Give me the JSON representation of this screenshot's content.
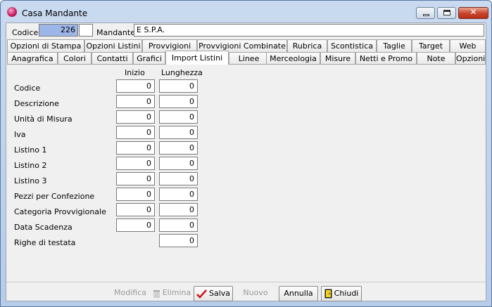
{
  "window": {
    "title": "Casa Mandante"
  },
  "header": {
    "codice_label": "Codice",
    "codice_value": "226",
    "mandante_label": "Mandante",
    "mandante_value": "E        S.P.A."
  },
  "tabs_row1": [
    "Opzioni di Stampa",
    "Opzioni Listini",
    "Provvigioni",
    "Provvigioni Combinate",
    "Rubrica",
    "Scontistica",
    "Taglie",
    "Target",
    "Web"
  ],
  "tabs_row2": [
    "Anagrafica",
    "Colori",
    "Contatti",
    "Grafici",
    "Import Listini",
    "Linee",
    "Merceologia",
    "Misure",
    "Netti e Promo",
    "Note",
    "Opzioni"
  ],
  "active_tab": "Import Listini",
  "import": {
    "col_inizio": "Inizio",
    "col_lunghezza": "Lunghezza",
    "rows": [
      {
        "label": "Codice",
        "inizio": "0",
        "lunghezza": "0"
      },
      {
        "label": "Descrizione",
        "inizio": "0",
        "lunghezza": "0"
      },
      {
        "label": "Unità di Misura",
        "inizio": "0",
        "lunghezza": "0"
      },
      {
        "label": "Iva",
        "inizio": "0",
        "lunghezza": "0"
      },
      {
        "label": "Listino 1",
        "inizio": "0",
        "lunghezza": "0"
      },
      {
        "label": "Listino 2",
        "inizio": "0",
        "lunghezza": "0"
      },
      {
        "label": "Listino 3",
        "inizio": "0",
        "lunghezza": "0"
      },
      {
        "label": "Pezzi per Confezione",
        "inizio": "0",
        "lunghezza": "0"
      },
      {
        "label": "Categoria Provvigionale",
        "inizio": "0",
        "lunghezza": "0"
      },
      {
        "label": "Data Scadenza",
        "inizio": "0",
        "lunghezza": "0"
      },
      {
        "label": "Righe di testata",
        "inizio": null,
        "lunghezza": "0"
      }
    ]
  },
  "toolbar": {
    "modifica": "Modifica",
    "elimina": "Elimina",
    "salva": "Salva",
    "nuovo": "Nuovo",
    "annulla": "Annulla",
    "chiudi": "Chiudi"
  },
  "colors": {
    "accent_field": "#9db6e8",
    "title_bar": "#c9daf0",
    "close_button": "#c7432a"
  }
}
